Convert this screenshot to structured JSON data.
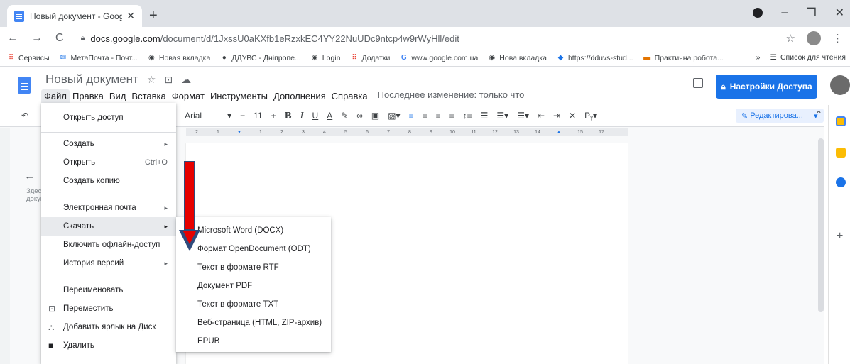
{
  "browser": {
    "tab_title": "Новый документ - Google Доку",
    "tab_close": "✕",
    "new_tab": "+",
    "url_host": "docs.google.com",
    "url_path": "/document/d/1JxssU0aKXfb1eRzxkEC4YY22NuUDc9ntcp4w9rWyHll/edit",
    "controls": {
      "minimize": "–",
      "maximize": "❐",
      "close": "✕"
    },
    "nav": {
      "back": "←",
      "forward": "→",
      "reload": "C"
    },
    "star": "☆"
  },
  "bookmarks": [
    {
      "icon": "apps-icon",
      "glyph": "⠿",
      "label": "Сервисы"
    },
    {
      "icon": "mail-icon",
      "glyph": "✉",
      "label": "МетаПочта - Почт..."
    },
    {
      "icon": "globe-icon",
      "glyph": "◉",
      "label": "Новая вкладка"
    },
    {
      "icon": "site-icon",
      "glyph": "●",
      "label": "ДДУВС - Дніпропе..."
    },
    {
      "icon": "globe-icon",
      "glyph": "◉",
      "label": "Login"
    },
    {
      "icon": "apps-icon",
      "glyph": "⠿",
      "label": "Додатки"
    },
    {
      "icon": "google-icon",
      "glyph": "G",
      "label": "www.google.com.ua"
    },
    {
      "icon": "globe-icon",
      "glyph": "◉",
      "label": "Нова вкладка"
    },
    {
      "icon": "site-icon",
      "glyph": "◆",
      "label": "https://dduvs-stud..."
    },
    {
      "icon": "folder-icon",
      "glyph": "▬",
      "label": "Практична робота..."
    }
  ],
  "bookmarks_more": "»",
  "reading_list": "Список для чтения",
  "doc": {
    "title": "Новый документ",
    "menu": [
      "Файл",
      "Правка",
      "Вид",
      "Вставка",
      "Формат",
      "Инструменты",
      "Дополнения",
      "Справка"
    ],
    "last_edit": "Последнее изменение: только что",
    "share_label": "Настройки Доступа"
  },
  "toolbar": {
    "font": "Arial",
    "font_size": "11",
    "minus": "−",
    "plus": "+",
    "bold": "B",
    "italic": "I",
    "underline": "U",
    "text_color": "A",
    "mode": "Редактирова..."
  },
  "ruler_ticks": [
    "2",
    "1",
    "1",
    "2",
    "3",
    "4",
    "5",
    "6",
    "7",
    "8",
    "9",
    "10",
    "11",
    "12",
    "13",
    "14",
    "15",
    "17",
    "18"
  ],
  "outline": {
    "back": "←",
    "text": "Здесь докум"
  },
  "file_menu": {
    "share": "Открыть доступ",
    "create": "Создать",
    "open": "Открыть",
    "open_shortcut": "Ctrl+O",
    "copy": "Создать копию",
    "email": "Электронная почта",
    "download": "Скачать",
    "offline": "Включить офлайн-доступ",
    "history": "История версий",
    "rename": "Переименовать",
    "move": "Переместить",
    "shortcut": "Добавить ярлык на Диск",
    "delete": "Удалить"
  },
  "download_menu": [
    "Microsoft Word (DOCX)",
    "Формат OpenDocument (ODT)",
    "Текст в формате RTF",
    "Документ PDF",
    "Текст в формате TXT",
    "Веб-страница (HTML, ZIP-архив)",
    "EPUB"
  ],
  "colors": {
    "accent": "#1a73e8",
    "annotation_arrow": "#e60000",
    "annotation_border": "#2f4b7c"
  }
}
